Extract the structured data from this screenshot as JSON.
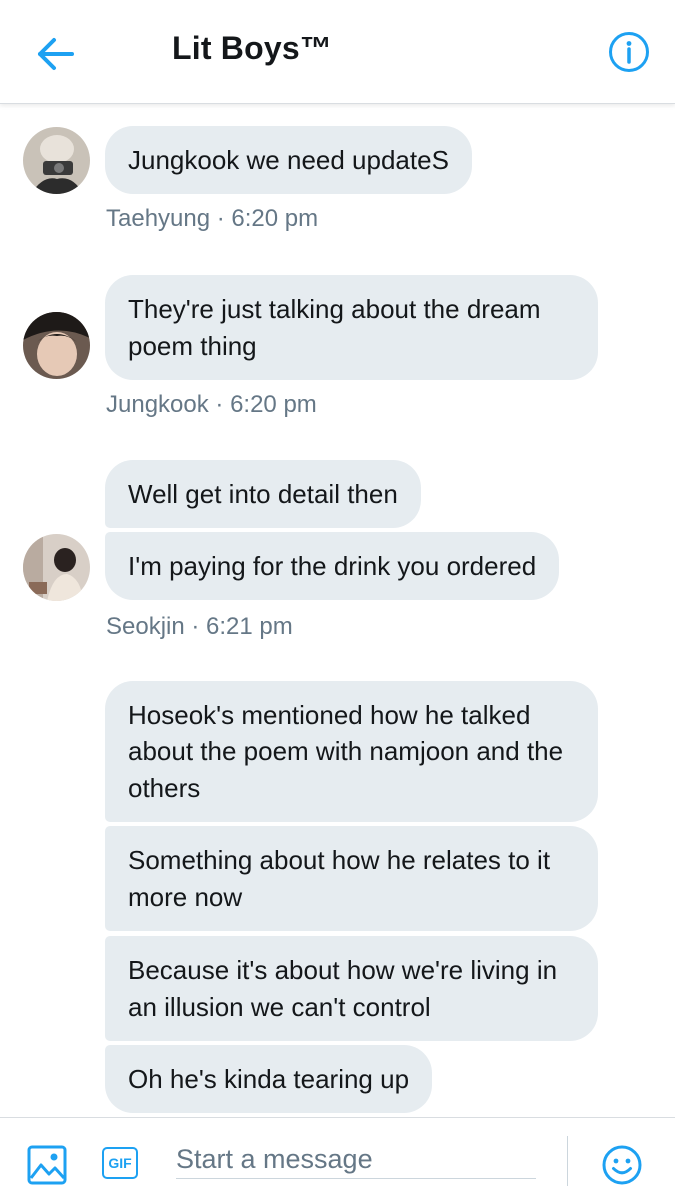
{
  "header": {
    "title": "Lit Boys™",
    "accent_color": "#1da1f2"
  },
  "messages": [
    {
      "sender": "Taehyung",
      "time": "6:20 pm",
      "bubbles": [
        "Jungkook we need updateS"
      ]
    },
    {
      "sender": "Jungkook",
      "time": "6:20 pm",
      "bubbles": [
        "They're just talking about the dream poem thing"
      ]
    },
    {
      "sender": "Seokjin",
      "time": "6:21 pm",
      "bubbles": [
        "Well get into detail then",
        "I'm paying for the drink you ordered"
      ]
    },
    {
      "sender": "",
      "time": "",
      "bubbles": [
        "Hoseok's mentioned how he talked about the poem with namjoon and the others",
        "Something about how he relates to it more now",
        "Because it's about how we're living in an illusion we can't control",
        "Oh he's kinda tearing up"
      ]
    }
  ],
  "meta": {
    "m0": "Taehyung · 6:20 pm",
    "m1": "Jungkook · 6:20 pm",
    "m2": "Seokjin · 6:21 pm"
  },
  "composer": {
    "gif_label": "GIF",
    "placeholder": "Start a message"
  },
  "icons": {
    "back": "arrow-left-icon",
    "info": "info-icon",
    "photo": "image-icon",
    "emoji": "smiley-icon"
  },
  "colors": {
    "bubble_bg": "#e6ecf0",
    "meta_text": "#657786",
    "accent": "#1da1f2"
  }
}
